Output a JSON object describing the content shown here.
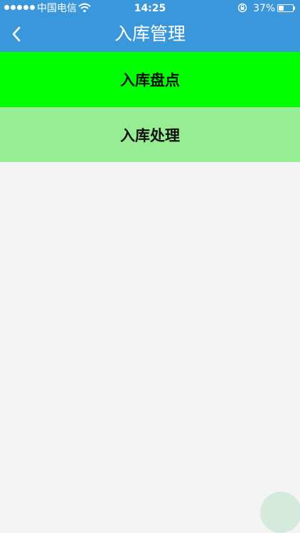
{
  "status_bar": {
    "carrier": "中国电信",
    "time": "14:25",
    "battery_percent": "37%",
    "battery_level": 0.37,
    "icons": [
      "signal-dots-icon",
      "wifi-icon",
      "rotation-lock-icon",
      "battery-icon"
    ]
  },
  "nav": {
    "title": "入库管理",
    "back_icon": "chevron-left-icon"
  },
  "menu": {
    "items": [
      {
        "label": "入库盘点",
        "color": "#00ff00"
      },
      {
        "label": "入库处理",
        "color": "#98ec93"
      }
    ]
  },
  "colors": {
    "nav_background": "#3a97dc",
    "page_background": "#f4f4f4",
    "floating_button": "#d3eadd"
  }
}
